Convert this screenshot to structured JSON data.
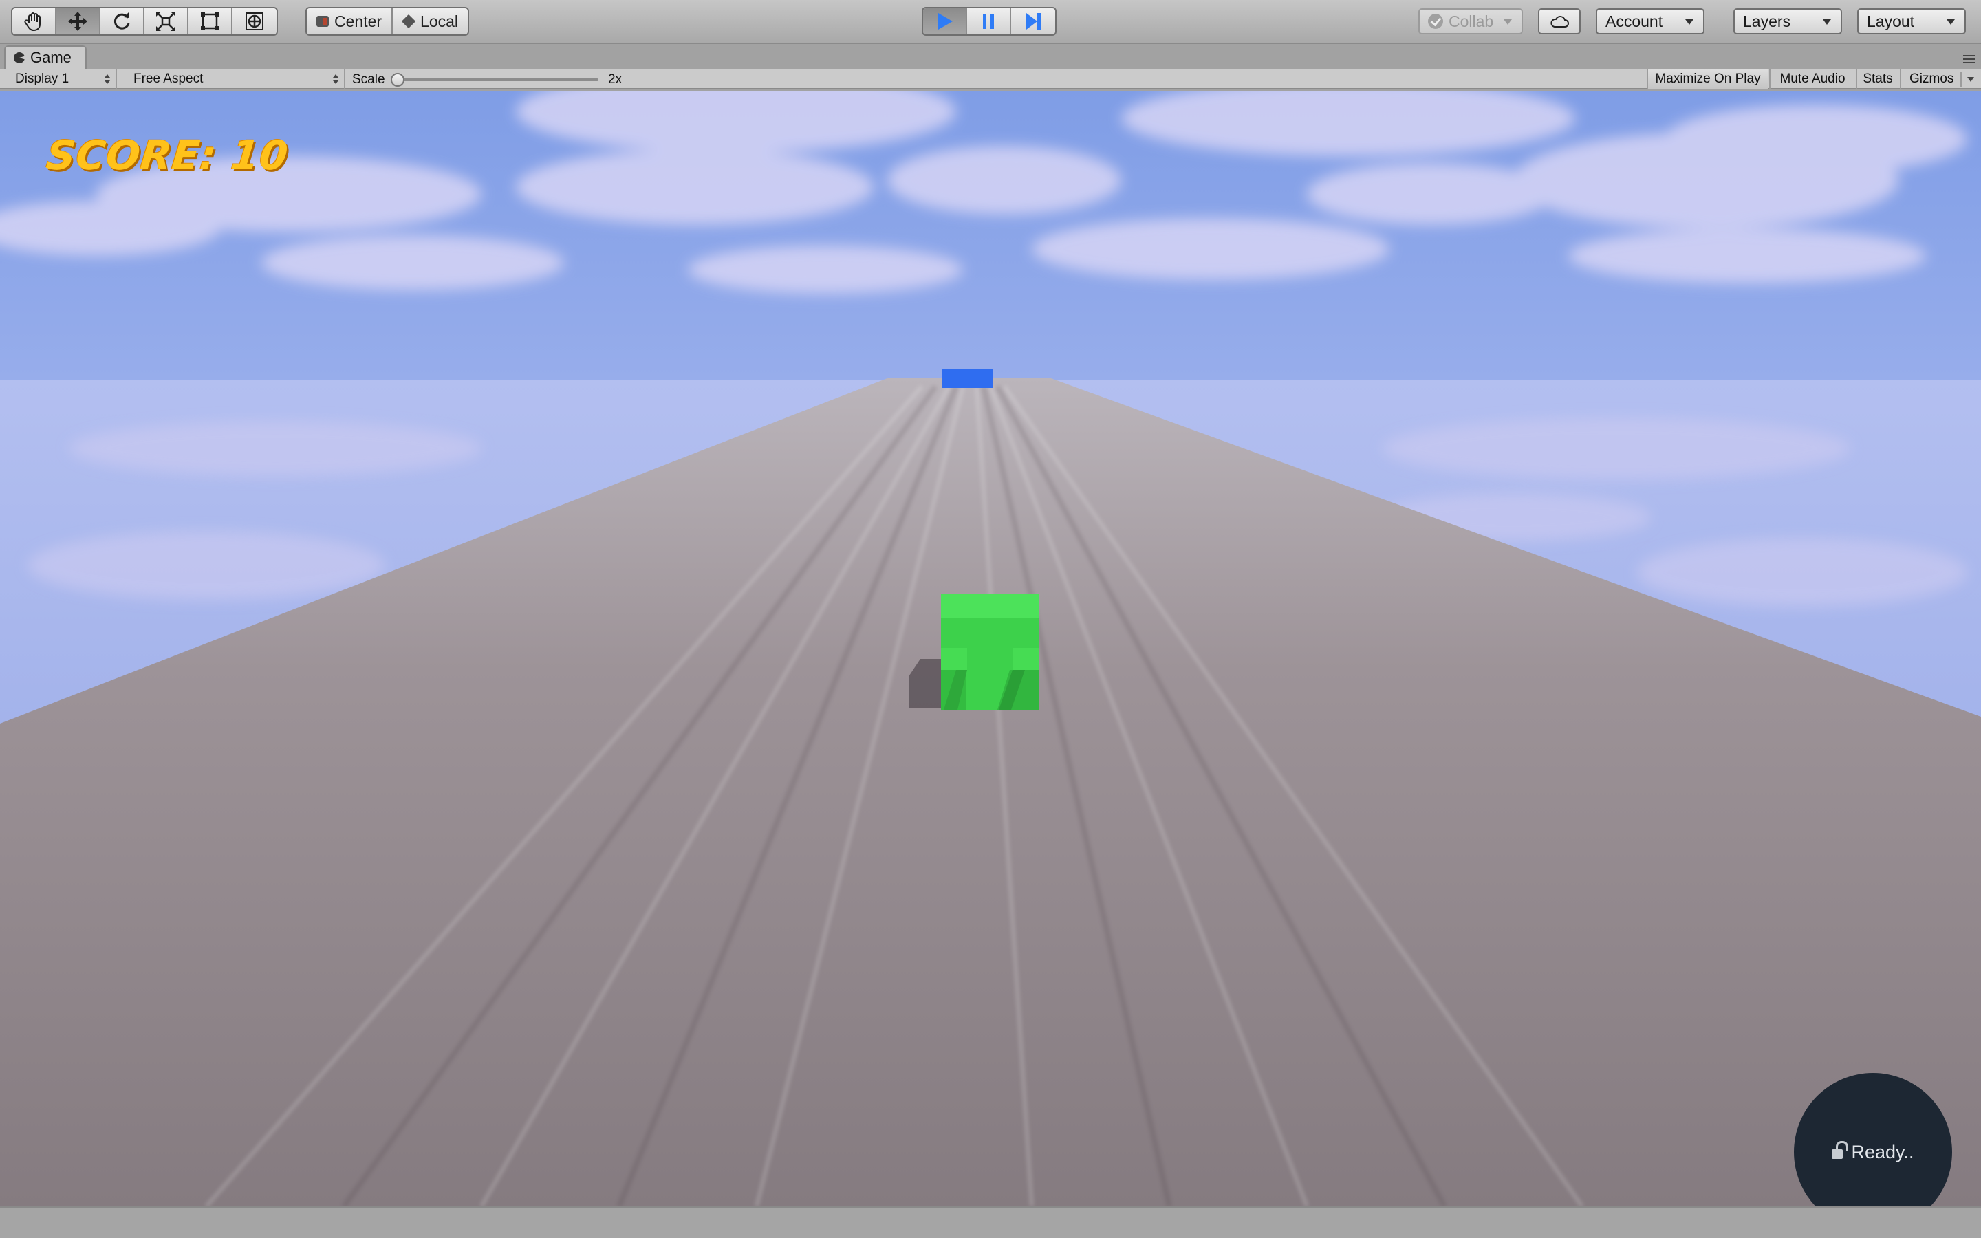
{
  "toolbar": {
    "tools": [
      {
        "name": "hand-tool",
        "icon": "hand-icon"
      },
      {
        "name": "move-tool",
        "icon": "move-arrows-icon"
      },
      {
        "name": "rotate-tool",
        "icon": "rotate-icon"
      },
      {
        "name": "scale-tool",
        "icon": "scale-icon"
      },
      {
        "name": "rect-tool",
        "icon": "rect-icon"
      },
      {
        "name": "transform-tool",
        "icon": "transform-icon"
      }
    ],
    "pivot_label": "Center",
    "space_label": "Local",
    "collab_label": "Collab",
    "account_label": "Account",
    "layers_label": "Layers",
    "layout_label": "Layout",
    "play_color": "#2f7cf6"
  },
  "game_window": {
    "tab_title": "Game",
    "display_option": "Display 1",
    "aspect_option": "Free Aspect",
    "scale_label": "Scale",
    "scale_value": "2x",
    "maximize_label": "Maximize On Play",
    "mute_label": "Mute Audio",
    "stats_label": "Stats",
    "gizmos_label": "Gizmos"
  },
  "game": {
    "score_text": "SCORE: 10",
    "player_color": "#3fd54e",
    "obstacle_color": "#2f6df0",
    "ready_text": "Ready.."
  }
}
